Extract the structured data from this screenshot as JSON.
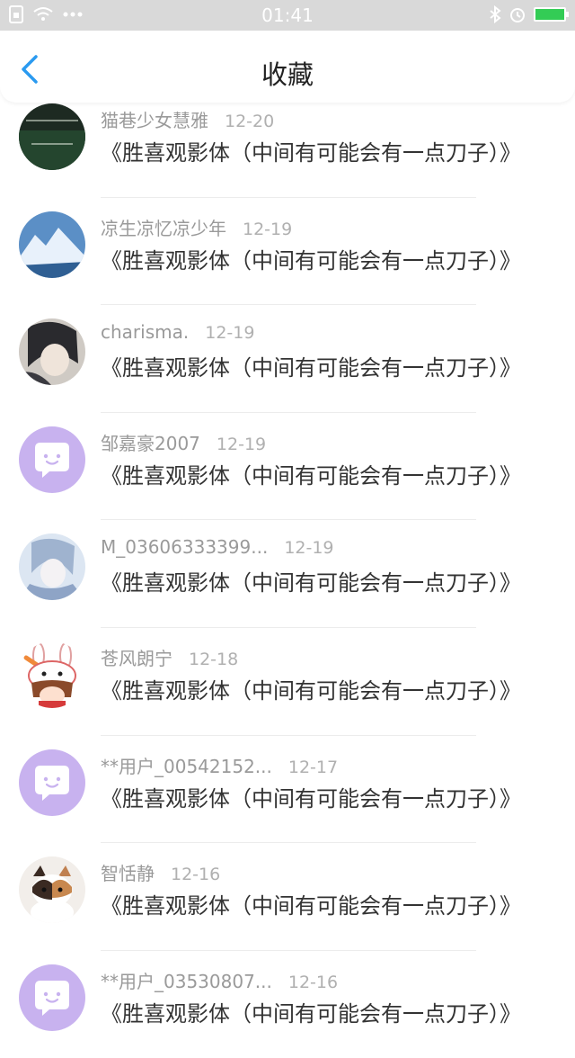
{
  "status_bar": {
    "time": "01:41"
  },
  "header": {
    "title": "收藏"
  },
  "items": [
    {
      "name": "猫巷少女慧雅",
      "date": "12-20",
      "title": "《胜喜观影体（中间有可能会有一点刀子）》",
      "avatar": "dark-text"
    },
    {
      "name": "凉生凉忆凉少年",
      "date": "12-19",
      "title": "《胜喜观影体（中间有可能会有一点刀子）》",
      "avatar": "mountain"
    },
    {
      "name": "charisma.",
      "date": "12-19",
      "title": "《胜喜观影体（中间有可能会有一点刀子）》",
      "avatar": "anime-dark"
    },
    {
      "name": "邹嘉豪2007",
      "date": "12-19",
      "title": "《胜喜观影体（中间有可能会有一点刀子）》",
      "avatar": "default"
    },
    {
      "name": "M_03606333399...",
      "date": "12-19",
      "title": "《胜喜观影体（中间有可能会有一点刀子）》",
      "avatar": "anime-light"
    },
    {
      "name": "苍风朗宁",
      "date": "12-18",
      "title": "《胜喜观影体（中间有可能会有一点刀子）》",
      "avatar": "cartoon-rabbit"
    },
    {
      "name": "**用户_00542152...",
      "date": "12-17",
      "title": "《胜喜观影体（中间有可能会有一点刀子）》",
      "avatar": "default"
    },
    {
      "name": "智恬静",
      "date": "12-16",
      "title": "《胜喜观影体（中间有可能会有一点刀子）》",
      "avatar": "cat"
    },
    {
      "name": "**用户_03530807...",
      "date": "12-16",
      "title": "《胜喜观影体（中间有可能会有一点刀子）》",
      "avatar": "default"
    }
  ],
  "colors": {
    "accent": "#2a9af0",
    "default_avatar": "#c8b2ef",
    "statusbar": "#d9d9d9"
  }
}
